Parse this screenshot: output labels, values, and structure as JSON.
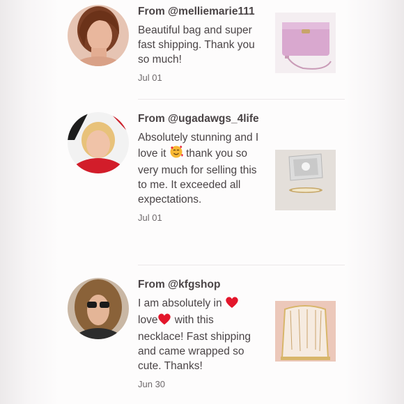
{
  "reviews": [
    {
      "from": "From @melliemarie111",
      "text": "Beautiful bag and super fast shipping. Thank you so much!",
      "date": "Jul 01",
      "avatar_icon": "avatar-photo-woman-auburn-hair",
      "thumb_icon": "pink-leather-crossbody-bag"
    },
    {
      "from": "From @ugadawgs_4life",
      "text_a": "Absolutely stunning and I love it",
      "emoji": "smiling-face-with-hearts",
      "text_b": "thank you so very much for selling this to me. It exceeded all expectations.",
      "date": "Jul 01",
      "avatar_icon": "avatar-photo-blonde-woman-red-top",
      "thumb_icon": "jewelry-box-with-bracelet"
    },
    {
      "from": "From @kfgshop",
      "text_a": "I am absolutely in",
      "emoji_1": "red-heart",
      "text_b": "love",
      "emoji_2": "red-heart",
      "text_c": "with this necklace! Fast shipping and came wrapped so cute. Thanks!",
      "date": "Jun 30",
      "avatar_icon": "avatar-photo-woman-sunglasses",
      "thumb_icon": "necklaces-on-display-stand"
    }
  ]
}
